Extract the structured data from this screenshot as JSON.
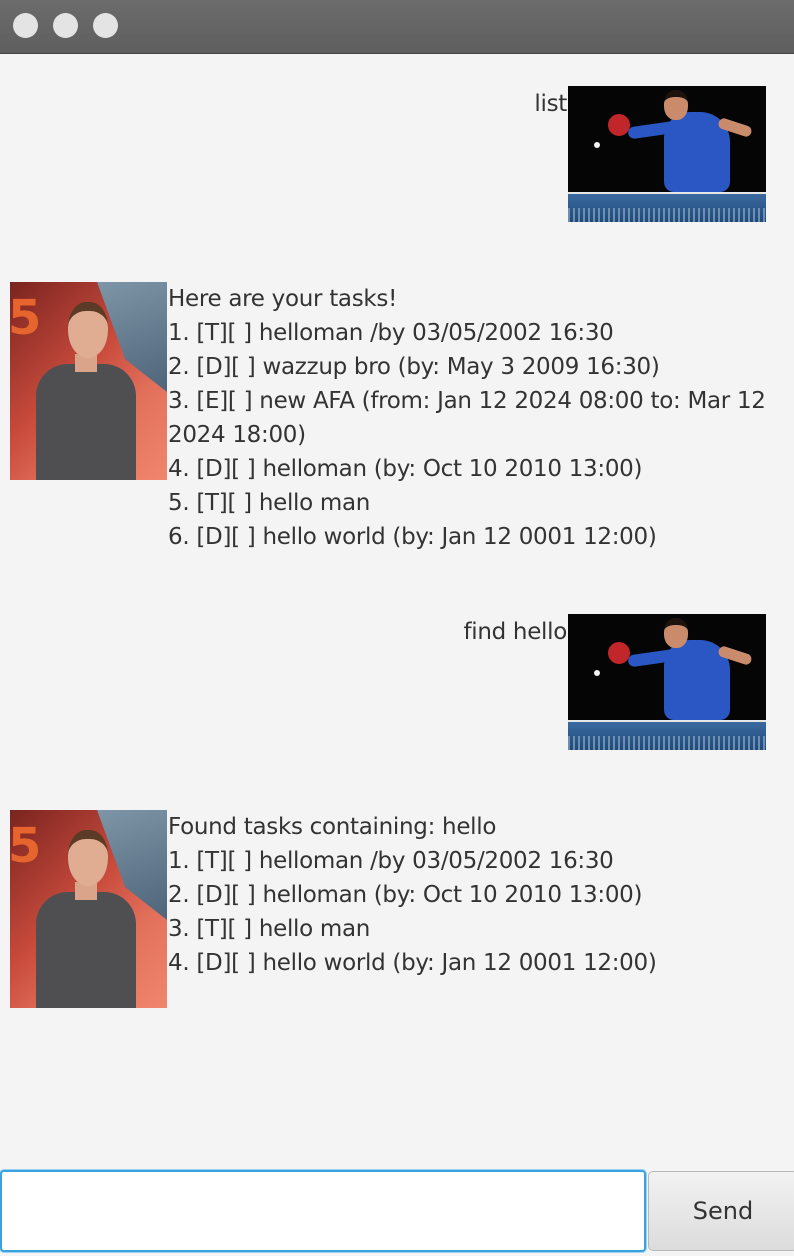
{
  "window": {
    "traffic_lights": [
      "close",
      "minimize",
      "maximize"
    ]
  },
  "dialogs": [
    {
      "role": "user",
      "text": "list",
      "avatar": "ping-pong-player-avatar"
    },
    {
      "role": "bot",
      "text": "Here are your tasks!\n1. [T][ ] helloman /by 03/05/2002 16:30\n2. [D][ ] wazzup bro (by: May 3 2009 16:30)\n3. [E][ ] new AFA (from: Jan 12 2024 08:00 to: Mar 12\n2024 18:00)\n4. [D][ ] helloman (by: Oct 10 2010 13:00)\n5. [T][ ] hello man\n6. [D][ ] hello world (by: Jan 12 0001 12:00)",
      "avatar": "bot-person-avatar",
      "avatar_text": "5"
    },
    {
      "role": "user",
      "text": "find hello",
      "avatar": "ping-pong-player-avatar"
    },
    {
      "role": "bot",
      "text": "Found tasks containing: hello\n1. [T][ ] helloman /by 03/05/2002 16:30\n2. [D][ ] helloman (by: Oct 10 2010 13:00)\n3. [T][ ] hello man\n4. [D][ ] hello world (by: Jan 12 0001 12:00)",
      "avatar": "bot-person-avatar",
      "avatar_text": "5"
    }
  ],
  "input": {
    "value": "",
    "placeholder": ""
  },
  "send_button": {
    "label": "Send"
  },
  "colors": {
    "background": "#f4f4f4",
    "input_focus": "#3aa2df",
    "titlebar": "#646464"
  }
}
